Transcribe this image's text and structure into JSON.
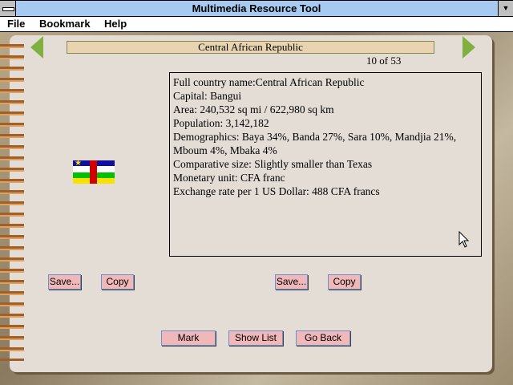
{
  "window": {
    "title": "Multimedia Resource Tool"
  },
  "menu": [
    "File",
    "Bookmark",
    "Help"
  ],
  "country": {
    "name": "Central African Republic",
    "position": "10 of 53"
  },
  "info_lines": [
    "Full country name:Central African Republic",
    "Capital: Bangui",
    "Area: 240,532 sq mi / 622,980 sq km",
    "Population: 3,142,182",
    "Demographics: Baya 34%, Banda 27%, Sara 10%, Mandjia 21%, Mboum 4%, Mbaka 4%",
    "Comparative size: Slightly smaller than Texas",
    "Monetary unit: CFA franc",
    "Exchange rate per 1 US Dollar: 488 CFA francs"
  ],
  "buttons": {
    "save": "Save...",
    "copy": "Copy",
    "mark": "Mark",
    "show_list": "Show List",
    "go_back": "Go Back"
  },
  "flag_colors": [
    "#1010a0",
    "#ffffff",
    "#00c000",
    "#f8e000",
    "#d00000"
  ]
}
